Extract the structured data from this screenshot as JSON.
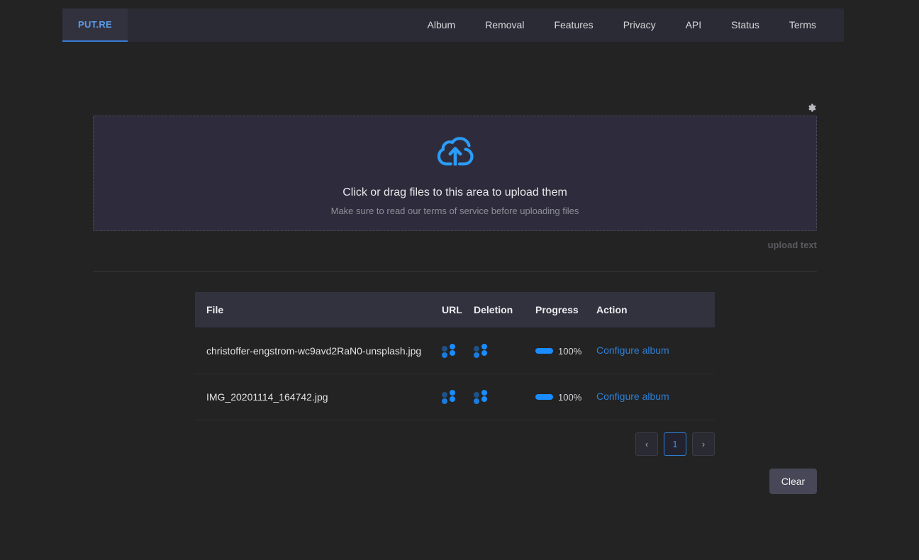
{
  "header": {
    "brand": "PUT.RE",
    "nav_items": [
      {
        "label": "Album"
      },
      {
        "label": "Removal"
      },
      {
        "label": "Features"
      },
      {
        "label": "Privacy"
      },
      {
        "label": "API"
      },
      {
        "label": "Status"
      },
      {
        "label": "Terms"
      }
    ]
  },
  "settings": {
    "gear_icon": "gear-icon"
  },
  "dropzone": {
    "icon": "cloud-upload-icon",
    "title": "Click or drag files to this area to upload them",
    "subtitle": "Make sure to read our terms of service before uploading files"
  },
  "upload_text_label": "upload text",
  "table": {
    "columns": [
      "File",
      "URL",
      "Deletion",
      "Progress",
      "Action"
    ],
    "rows": [
      {
        "file": "christoffer-engstrom-wc9avd2RaN0-unsplash.jpg",
        "url_icon": "loading-spinner-icon",
        "deletion_icon": "loading-spinner-icon",
        "progress": "100%",
        "action": "Configure album"
      },
      {
        "file": "IMG_20201114_164742.jpg",
        "url_icon": "loading-spinner-icon",
        "deletion_icon": "loading-spinner-icon",
        "progress": "100%",
        "action": "Configure album"
      }
    ]
  },
  "pagination": {
    "prev": "‹",
    "pages": [
      "1"
    ],
    "next": "›",
    "current_page": "1"
  },
  "clear_button": "Clear",
  "colors": {
    "accent_blue": "#1a8cff",
    "link_blue": "#2e7fd4",
    "brand_blue": "#5b9bea",
    "page_bg": "#232323",
    "nav_bg": "#2b2b35",
    "dropzone_bg": "#2e2c3c",
    "table_head_bg": "#32323f",
    "clear_btn_bg": "#474757"
  }
}
